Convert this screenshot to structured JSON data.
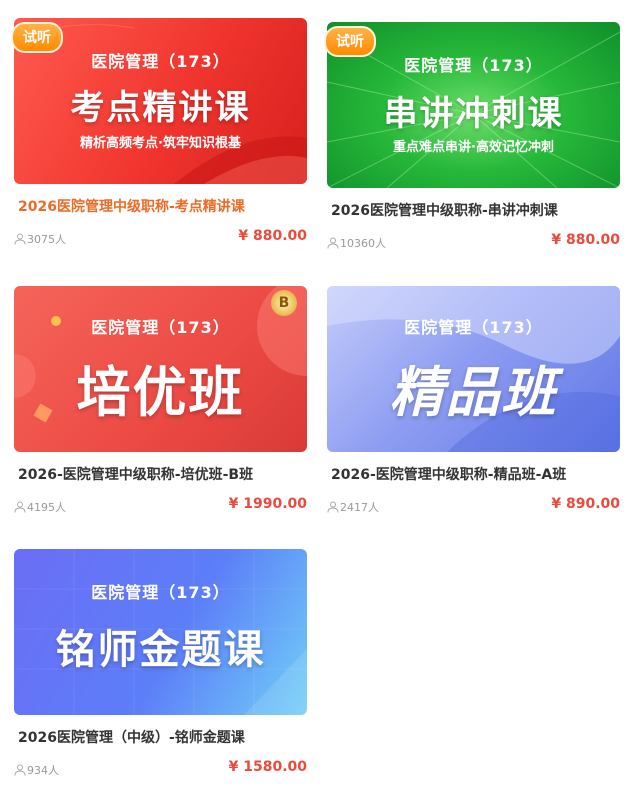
{
  "trial_badge": "试听",
  "courses": [
    {
      "thumb_subtitle": "医院管理（173）",
      "thumb_main": "考点精讲课",
      "thumb_tagline": "精析高频考点·筑牢知识根基",
      "title": "2026医院管理中级职称-考点精讲课",
      "students": "3075人",
      "price": "¥ 880.00"
    },
    {
      "thumb_subtitle": "医院管理（173）",
      "thumb_main": "串讲冲刺课",
      "thumb_tagline": "重点难点串讲·高效记忆冲刺",
      "title": "2026医院管理中级职称-串讲冲刺课",
      "students": "10360人",
      "price": "¥ 880.00"
    },
    {
      "thumb_subtitle": "医院管理（173）",
      "thumb_main": "培优班",
      "title": "2026-医院管理中级职称-培优班-B班",
      "students": "4195人",
      "price": "¥ 1990.00"
    },
    {
      "thumb_subtitle": "医院管理（173）",
      "thumb_main": "精品班",
      "title": "2026-医院管理中级职称-精品班-A班",
      "students": "2417人",
      "price": "¥ 890.00"
    },
    {
      "thumb_subtitle": "医院管理（173）",
      "thumb_main": "铭师金题课",
      "title": "2026医院管理（中级）-铭师金题课",
      "students": "934人",
      "price": "¥ 1580.00"
    }
  ],
  "colors": {
    "price": "#e94b3c",
    "title_highlight": "#ee6a25",
    "trial_badge": "#ff8a00"
  }
}
